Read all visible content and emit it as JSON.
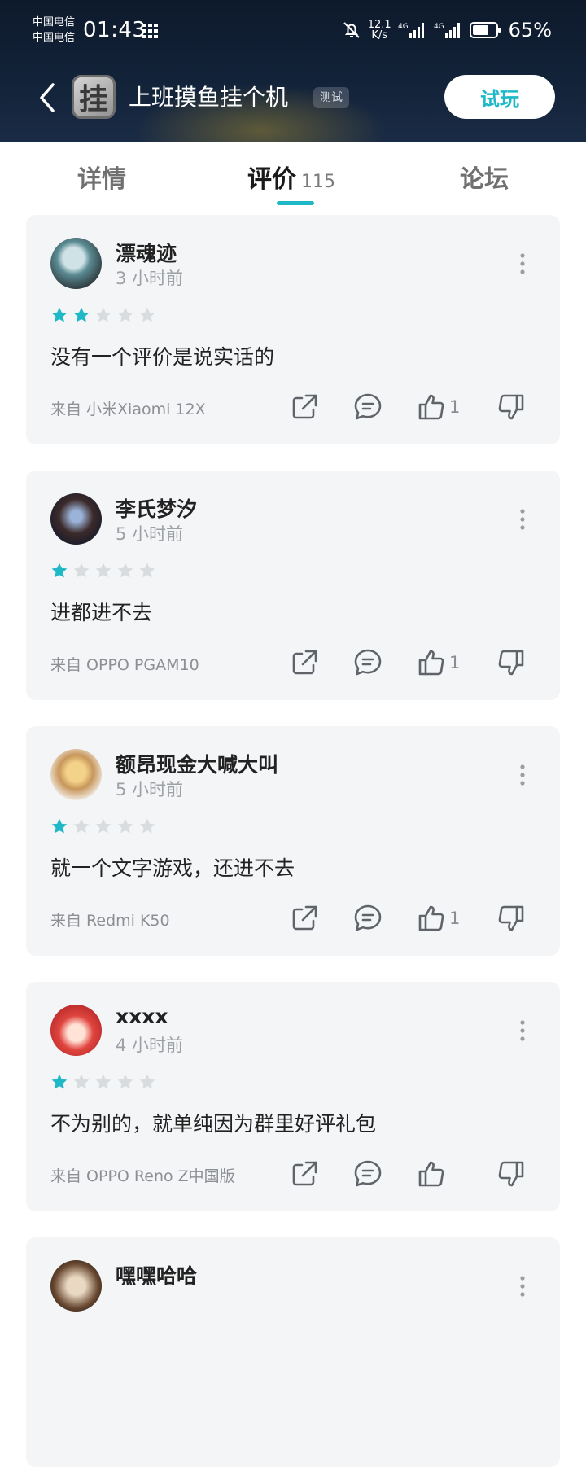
{
  "status_bar": {
    "carrier1": "中国电信",
    "carrier2": "中国电信",
    "time": "01:43",
    "net_speed_value": "12.1",
    "net_speed_unit": "K/s",
    "network1": "4G",
    "network2": "4G",
    "battery": "65%"
  },
  "header": {
    "app_icon_char": "挂",
    "title": "上班摸鱼挂个机",
    "badge": "测试",
    "try_button": "试玩"
  },
  "tabs": {
    "details": "详情",
    "reviews": "评价",
    "reviews_count": "115",
    "forum": "论坛",
    "active": "reviews"
  },
  "accent_color": "#1fb8c7",
  "reviews": [
    {
      "user": "漂魂迹",
      "time": "3 小时前",
      "rating": 2,
      "text": "没有一个评价是说实话的",
      "device": "来自 小米Xiaomi 12X",
      "likes": "1"
    },
    {
      "user": "李氏梦汐",
      "time": "5 小时前",
      "rating": 1,
      "text": "进都进不去",
      "device": "来自 OPPO PGAM10",
      "likes": "1"
    },
    {
      "user": "额昂现金大喊大叫",
      "time": "5 小时前",
      "rating": 1,
      "text": "就一个文字游戏，还进不去",
      "device": "来自 Redmi K50",
      "likes": "1"
    },
    {
      "user": "xxxx",
      "time": "4 小时前",
      "rating": 1,
      "text": "不为别的，就单纯因为群里好评礼包",
      "device": "来自 OPPO Reno Z中国版",
      "likes": ""
    },
    {
      "user": "嘿嘿哈哈",
      "time": "",
      "rating": 0,
      "text": "",
      "device": "",
      "likes": ""
    }
  ]
}
